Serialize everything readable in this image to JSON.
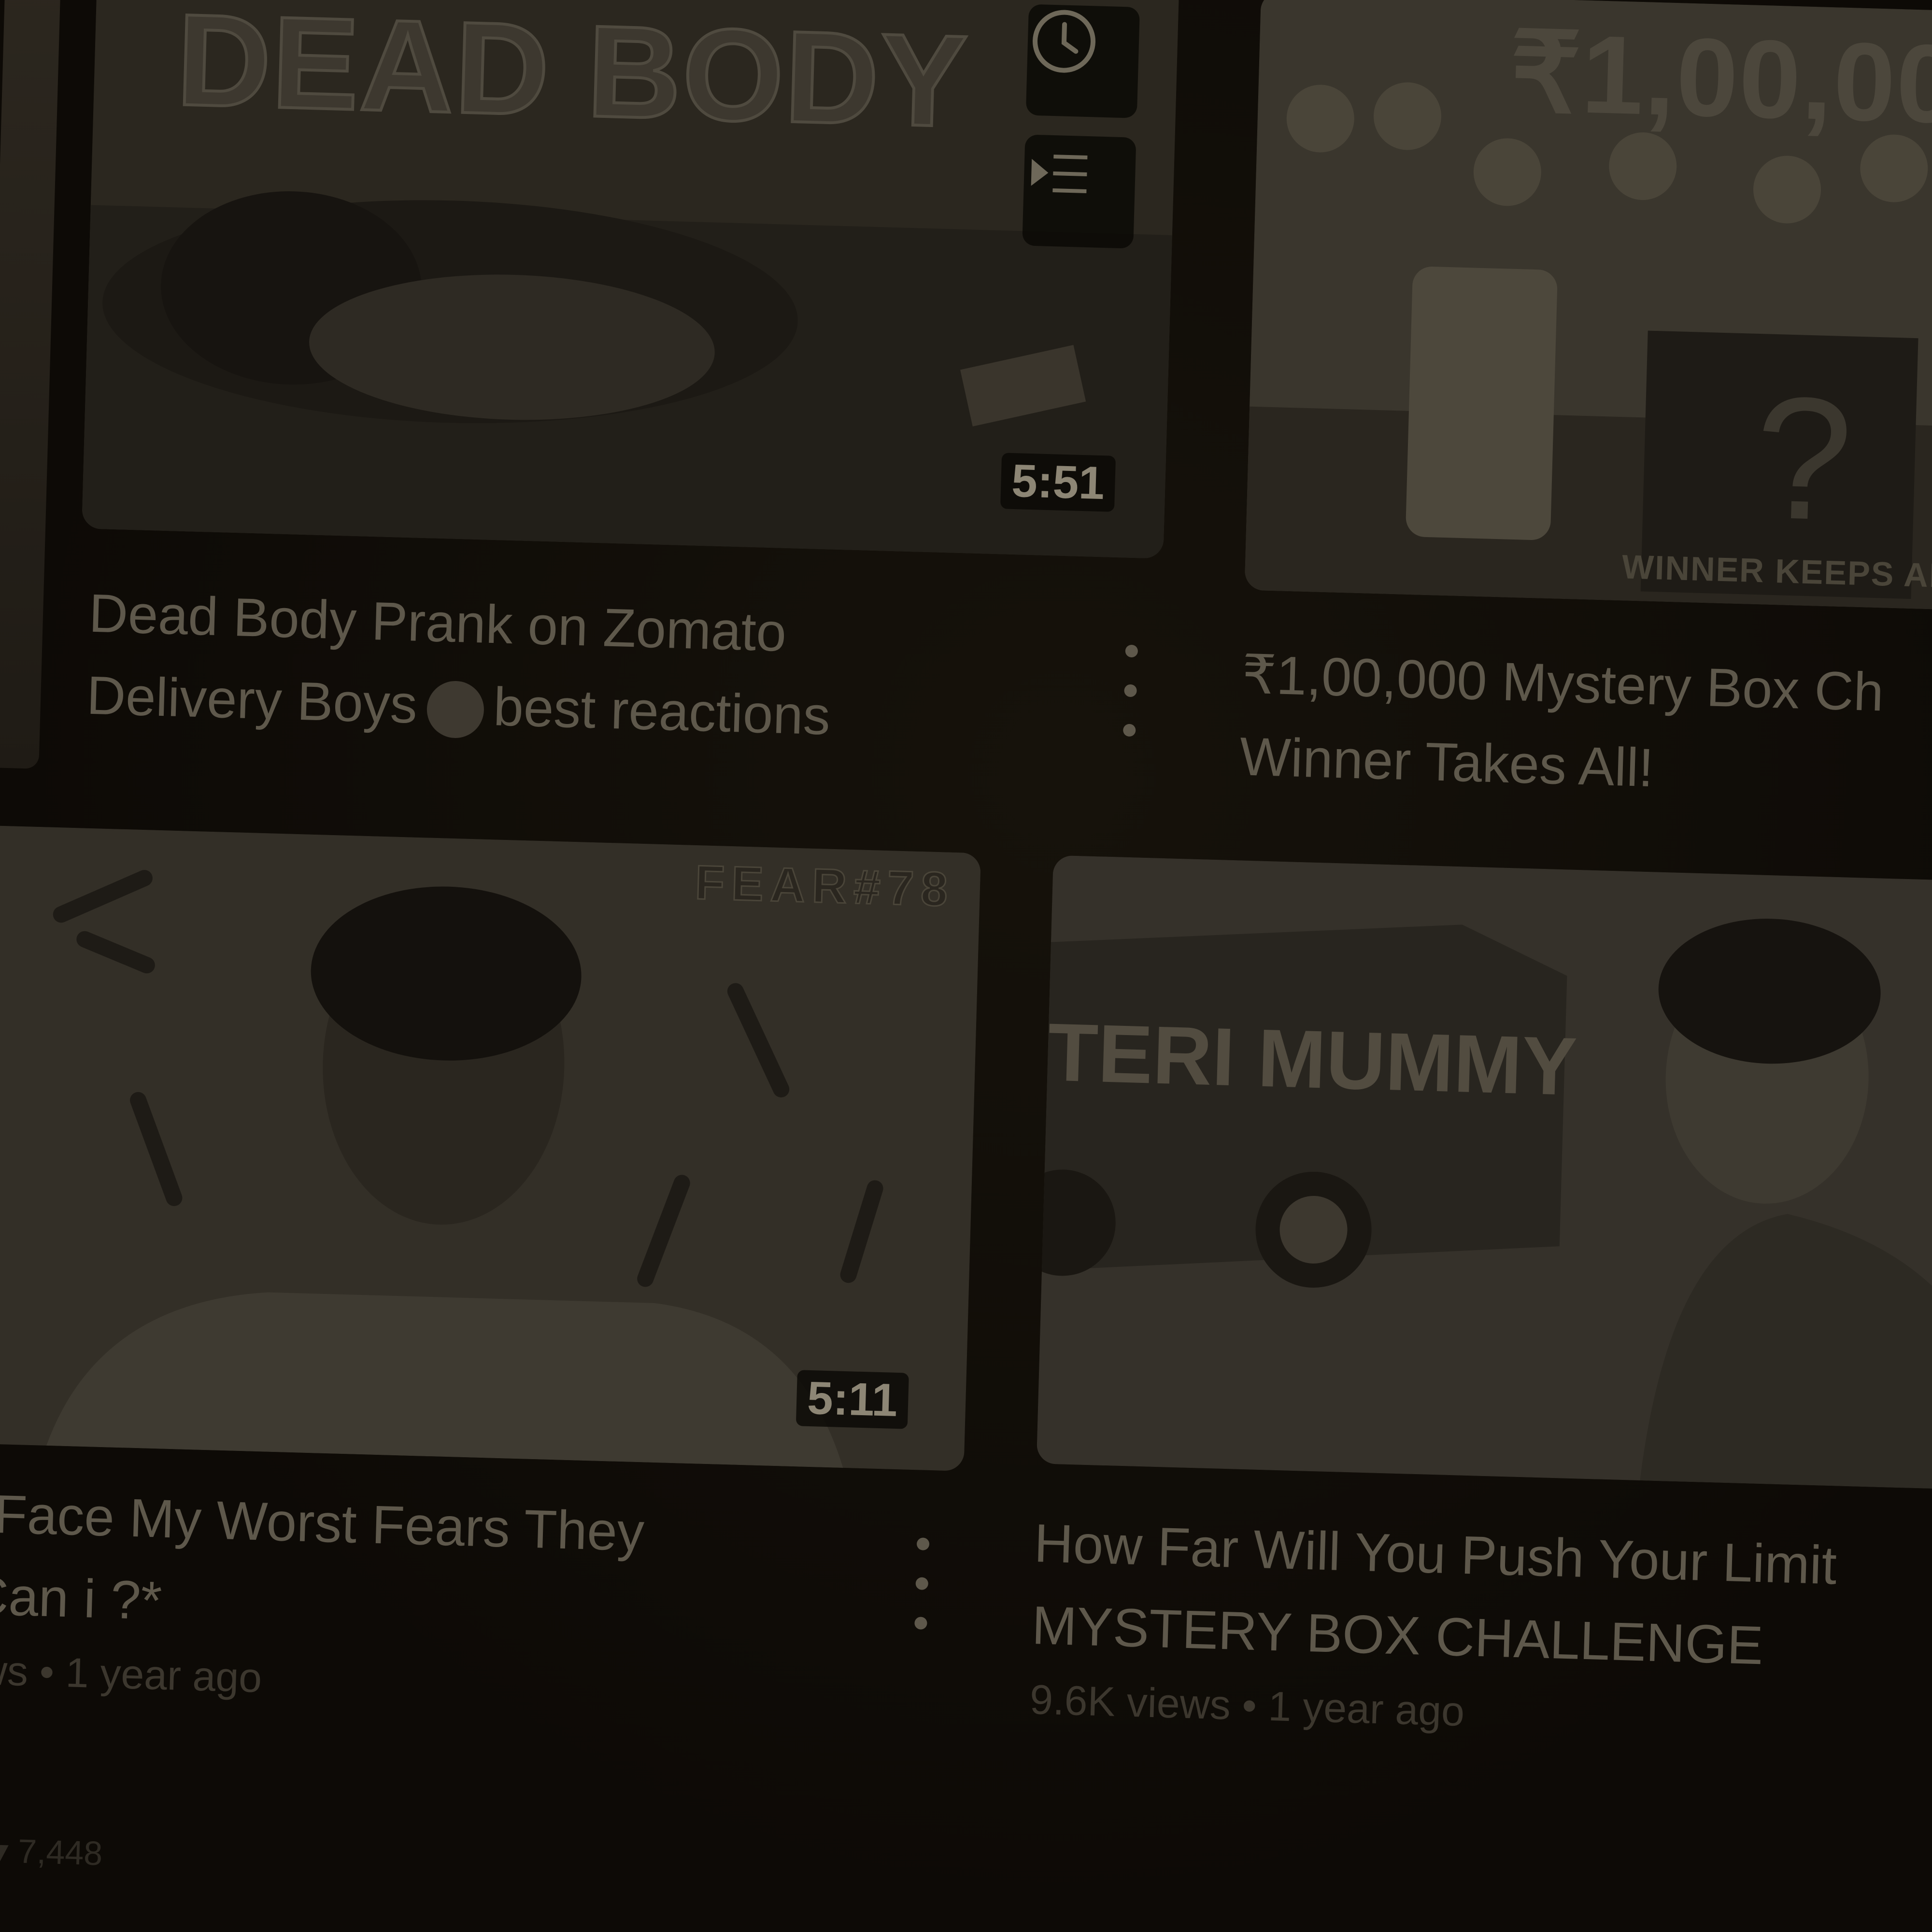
{
  "videos": [
    {
      "title_line1": "Dead Body Prank on Zomato",
      "title_line2_a": "Delivery Boys",
      "title_line2_b": "best reactions",
      "duration": "5:51",
      "thumb_text": "DEAD BODY"
    },
    {
      "title_line1": "₹1,00,000 Mystery Box Ch",
      "title_line2": "Winner Takes All!",
      "thumb_text": "₹1,00,00",
      "thumb_caption": "WINNER KEEPS AL"
    },
    {
      "title_line1": "n't Face My Worst Fears They",
      "title_line2": "l *Can i ?*",
      "views": "views",
      "age": "1 year ago",
      "duration": "5:11",
      "thumb_text": "FEAR#78"
    },
    {
      "title_line1": "How Far Will You Push Your Limit",
      "title_line2": "MYSTERY BOX CHALLENGE",
      "views": "9.6K views",
      "age": "1 year ago",
      "thumb_text": "TERI MUMMY"
    }
  ],
  "meta_separator": "•",
  "bottom_count": "7,448",
  "colors": {
    "background": "#0d0a06",
    "text": "#5e584b",
    "muted": "#3c372e"
  },
  "icons": [
    "clock-icon",
    "queue-icon",
    "kebab-icon",
    "like-icon"
  ]
}
